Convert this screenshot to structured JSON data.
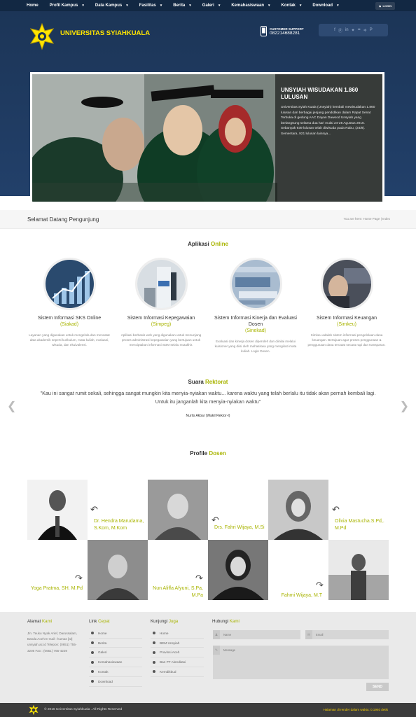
{
  "topnav": {
    "items": [
      {
        "label": "Home",
        "caret": false
      },
      {
        "label": "Profil Kampus",
        "caret": true
      },
      {
        "label": "Data Kampus",
        "caret": true
      },
      {
        "label": "Fasilitas",
        "caret": true
      },
      {
        "label": "Berita",
        "caret": true
      },
      {
        "label": "Galeri",
        "caret": true
      },
      {
        "label": "Kemahasiswaan",
        "caret": true
      },
      {
        "label": "Kontak",
        "caret": true
      },
      {
        "label": "Download",
        "caret": true
      }
    ],
    "login": "LOGIN"
  },
  "header": {
    "title": "UNIVERSITAS SYIAHKUALA",
    "cs_label": "CUSTOMER SUPPORT",
    "cs_phone": "082214688281",
    "social_icons": [
      "facebook-icon",
      "skype-icon",
      "linkedin-icon",
      "twitter-icon",
      "flickr-icon",
      "rss-icon",
      "pinterest-icon"
    ],
    "brand_color": "#ffe400"
  },
  "slider": {
    "title": "UNSYIAH WISUDAKAN 1.860 LULUSAN",
    "body": "Universitas Syiah Kuala (Unsyiah) kembali mewisudakan 1.860 lulusan dari berbagai jenjang pendidikan dalam Rapat Senat Terbuka di gedung AAC Dayan Dawood Unsyiah yang berlangsung selama dua hari mulai 24-25 Agustus 2016. Sebanyak 939 lulusan telah diwisuda pada Rabu, (24/8). Sementara, 921 lulusan lainnya..."
  },
  "breadcrumb": {
    "welcome": "Selamat Datang Pengunjung",
    "trail": "You are here:  Home Page | Index"
  },
  "apps": {
    "heading": "Aplikasi",
    "heading_accent": "Online",
    "items": [
      {
        "title": "Sistem Informasi SKS Online",
        "sub": "(Siakad)",
        "desc": "Layanan yang digunakan untuk mengelola dan mencatat data akademik seperti kurikulum, mata kuliah, evaluasi, wisuda, dan ekuivalensi."
      },
      {
        "title": "Sistem Informasi Kepegawaian",
        "sub": "(Simpeg)",
        "desc": "Aplikasi berbasis web yang digunakan untuk menunjang proses administrasi kepegawaian yang bertujuan untuk menciptakan informasi SDM selalu mutakhir."
      },
      {
        "title": "Sistem Informasi Kinerja dan Evaluasi Dosen",
        "sub": "(Sinekad)",
        "desc": "Evaluasi dan kinerja dosen diperoleh dan diinilai melalui kuisioner yang diisi oleh mahasiswa yang mengikuti mata kuliah. Login Dosen."
      },
      {
        "title": "Sistem Informasi Keuangan",
        "sub": "(Simkeu)",
        "desc": "Simkeu adalah sistem informasi pengelolaan dana keuangan. Bertujuan agar proses penggunaan & penggunaan dana tercatat secara rapi dan transparan."
      }
    ]
  },
  "rektorat": {
    "heading": "Suara",
    "heading_accent": "Rektorat",
    "quote": "\"Kau ini sangat rumit sekali, sehingga sangat mungkin kita menyia-nyiakan waktu... karena waktu yang telah berlalu itu tidak akan pernah kembali lagi. Untuk itu janganlah kita menyia-nyiakan waktu\"",
    "author": "Nurlis Akbar (Wakil Rektor-I)"
  },
  "dosen": {
    "heading": "Profile",
    "heading_accent": "Dosen",
    "items": [
      {
        "name": "Dr. Hendra Marudama, S.Kom, M.Kom"
      },
      {
        "name": "Drs. Fahri Wijaya, M.Si"
      },
      {
        "name": "Olivia Mastucha.S.Pd,. M.Pd"
      },
      {
        "name": "Yoga Pratma, SH. M.Pd"
      },
      {
        "name": "Nun Aliffa Afyuni, S.Pa, M.Pa"
      },
      {
        "name": "Fahmi Wijaya, M.T"
      }
    ]
  },
  "footer": {
    "alamat_title": "Alamat",
    "alamat_accent": "Kami",
    "alamat": "Jln. Teuku Nyak Arief, Darussalam, Banda Aceh E-mail : humas [at] unsyiah.ac.id Telepon: (0651) 755-3205 Fax : (0651) 755-4229",
    "link_title": "Link",
    "link_accent": "Cepat",
    "links": [
      "Home",
      "Berita",
      "Galeri",
      "Kemahasiswaan",
      "Kontak",
      "Download"
    ],
    "kunjungi_title": "Kunjungi",
    "kunjungi_accent": "Juga",
    "kunjungi": [
      "Home",
      "BEM Unsyiah",
      "Provinsi Aceh",
      "Ban PT Akreditasi",
      "Kemdikbud"
    ],
    "hubungi_title": "Hubungi",
    "hubungi_accent": "Kami",
    "name_placeholder": "Name",
    "email_placeholder": "Email",
    "message_placeholder": "Message",
    "send": "SEND"
  },
  "bottom": {
    "copyright": "© 2016 Universitas Syiahkuala . All Rights Reserved",
    "render": "Halaman di render dalam waktu: 0.1940 detik"
  }
}
